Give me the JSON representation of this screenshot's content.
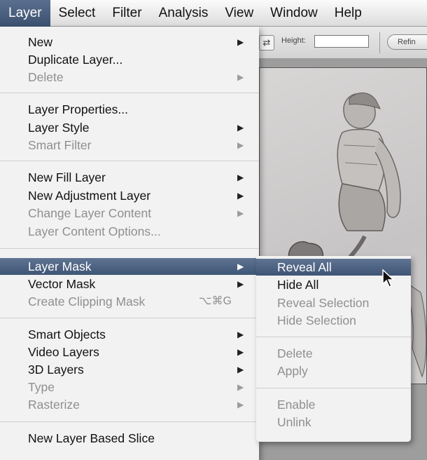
{
  "menubar": {
    "items": [
      {
        "label": "Layer",
        "active": true
      },
      {
        "label": "Select"
      },
      {
        "label": "Filter"
      },
      {
        "label": "Analysis"
      },
      {
        "label": "View"
      },
      {
        "label": "Window"
      },
      {
        "label": "Help"
      }
    ]
  },
  "toolbar": {
    "height_label": "Height:",
    "height_value": "",
    "refine_label": "Refin",
    "swap_icon": "swap-arrows-icon"
  },
  "layer_menu": {
    "items": [
      {
        "label": "New",
        "has_submenu": true,
        "disabled": false
      },
      {
        "label": "Duplicate Layer...",
        "has_submenu": false,
        "disabled": false
      },
      {
        "label": "Delete",
        "has_submenu": true,
        "disabled": true
      },
      {
        "label": "Layer Properties...",
        "has_submenu": false,
        "disabled": false
      },
      {
        "label": "Layer Style",
        "has_submenu": true,
        "disabled": false
      },
      {
        "label": "Smart Filter",
        "has_submenu": true,
        "disabled": true
      },
      {
        "label": "New Fill Layer",
        "has_submenu": true,
        "disabled": false
      },
      {
        "label": "New Adjustment Layer",
        "has_submenu": true,
        "disabled": false
      },
      {
        "label": "Change Layer Content",
        "has_submenu": true,
        "disabled": true
      },
      {
        "label": "Layer Content Options...",
        "has_submenu": false,
        "disabled": true
      },
      {
        "label": "Layer Mask",
        "has_submenu": true,
        "disabled": false,
        "highlighted": true
      },
      {
        "label": "Vector Mask",
        "has_submenu": true,
        "disabled": false
      },
      {
        "label": "Create Clipping Mask",
        "shortcut": "⌥⌘G",
        "disabled": true
      },
      {
        "label": "Smart Objects",
        "has_submenu": true,
        "disabled": false
      },
      {
        "label": "Video Layers",
        "has_submenu": true,
        "disabled": false
      },
      {
        "label": "3D Layers",
        "has_submenu": true,
        "disabled": false
      },
      {
        "label": "Type",
        "has_submenu": true,
        "disabled": true
      },
      {
        "label": "Rasterize",
        "has_submenu": true,
        "disabled": true
      },
      {
        "label": "New Layer Based Slice",
        "has_submenu": false,
        "disabled": false
      }
    ],
    "submenu_arrow": "▶"
  },
  "layer_mask_submenu": {
    "items": [
      {
        "label": "Reveal All",
        "highlighted": true,
        "disabled": false
      },
      {
        "label": "Hide All",
        "disabled": false
      },
      {
        "label": "Reveal Selection",
        "disabled": true
      },
      {
        "label": "Hide Selection",
        "disabled": true
      },
      {
        "label": "Delete",
        "disabled": true
      },
      {
        "label": "Apply",
        "disabled": true
      },
      {
        "label": "Enable",
        "disabled": true
      },
      {
        "label": "Unlink",
        "disabled": true
      }
    ]
  },
  "colors": {
    "highlight": "#4a6080",
    "menu_bg": "#f2f2f2",
    "disabled_text": "#8f8f8f"
  }
}
